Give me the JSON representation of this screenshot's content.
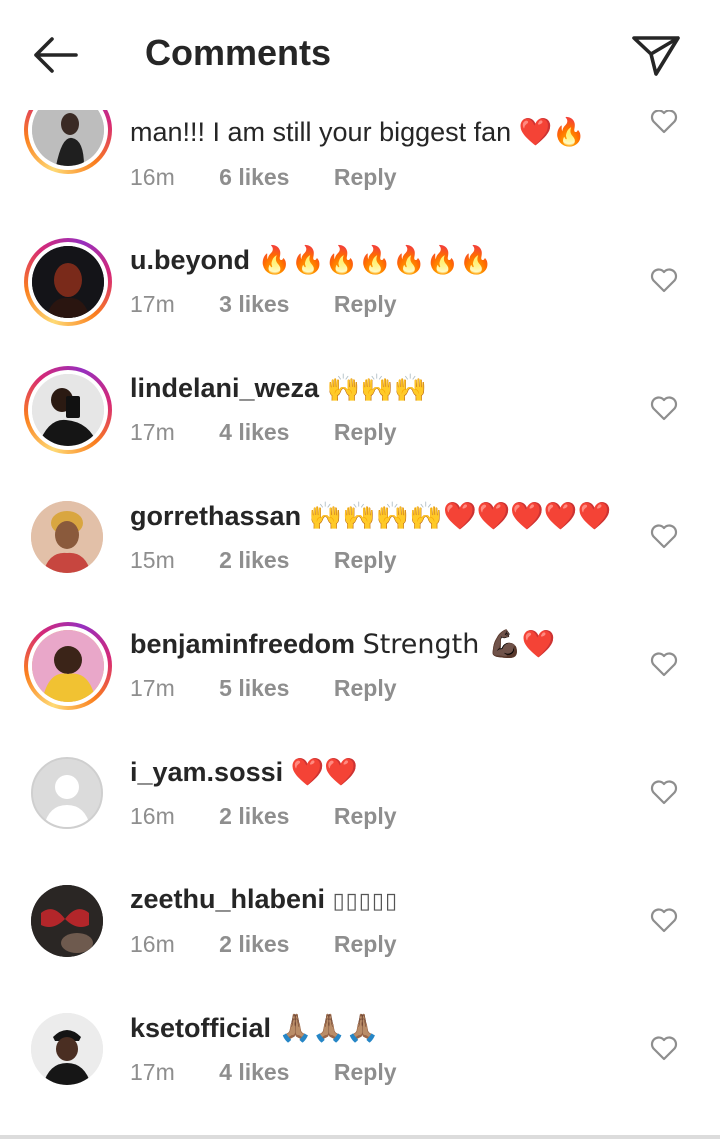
{
  "header": {
    "title": "Comments",
    "back_icon": "arrow-left-icon",
    "send_icon": "paper-plane-icon"
  },
  "comments": [
    {
      "username": "",
      "text": "man!!! I am still your biggest fan ❤️🔥",
      "time": "16m",
      "likes": "6 likes",
      "reply": "Reply",
      "story_ring": true
    },
    {
      "username": "u.beyond",
      "text": "🔥🔥🔥🔥🔥🔥🔥",
      "time": "17m",
      "likes": "3 likes",
      "reply": "Reply",
      "story_ring": true
    },
    {
      "username": "lindelani_weza",
      "text": "🙌🙌🙌",
      "time": "17m",
      "likes": "4 likes",
      "reply": "Reply",
      "story_ring": true
    },
    {
      "username": "gorrethassan",
      "text": "🙌🙌🙌🙌❤️❤️❤️❤️❤️",
      "time": "15m",
      "likes": "2 likes",
      "reply": "Reply",
      "story_ring": false
    },
    {
      "username": "benjaminfreedom",
      "text": "Strength 💪🏿❤️",
      "time": "17m",
      "likes": "5 likes",
      "reply": "Reply",
      "story_ring": true
    },
    {
      "username": "i_yam.sossi",
      "text": "❤️❤️",
      "time": "16m",
      "likes": "2 likes",
      "reply": "Reply",
      "story_ring": false
    },
    {
      "username": "zeethu_hlabeni",
      "text": "▯▯▯▯▯",
      "time": "16m",
      "likes": "2 likes",
      "reply": "Reply",
      "story_ring": false
    },
    {
      "username": "ksetofficial",
      "text": "🙏🏽🙏🏽🙏🏽",
      "time": "17m",
      "likes": "4 likes",
      "reply": "Reply",
      "story_ring": false
    }
  ],
  "colors": {
    "text": "#262626",
    "muted": "#8e8e8e",
    "heart": "#e0243a",
    "story_ring_start": "#feda75",
    "story_ring_end": "#962fbf"
  }
}
